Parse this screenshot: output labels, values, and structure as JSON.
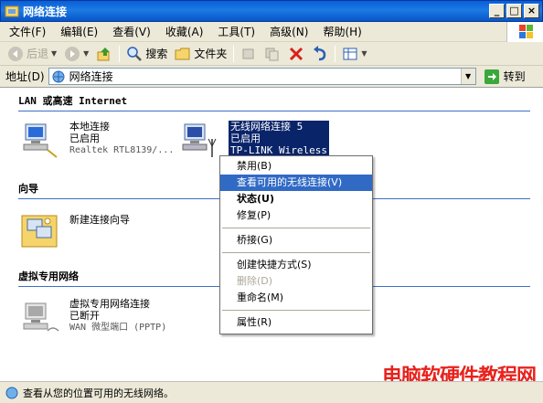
{
  "window": {
    "title": "网络连接"
  },
  "menu": [
    "文件(F)",
    "编辑(E)",
    "查看(V)",
    "收藏(A)",
    "工具(T)",
    "高级(N)",
    "帮助(H)"
  ],
  "toolbar": {
    "back": "后退",
    "search": "搜索",
    "folders": "文件夹"
  },
  "address": {
    "label": "地址(D)",
    "value": "网络连接",
    "go": "转到"
  },
  "groups": {
    "lan": "LAN 或高速 Internet",
    "wizard": "向导",
    "vpn": "虚拟专用网络"
  },
  "items": {
    "local": {
      "name": "本地连接",
      "status": "已启用",
      "device": "Realtek RTL8139/..."
    },
    "wireless": {
      "name": "无线网络连接 5",
      "status": "已启用",
      "device": "TP-LINK Wireless"
    },
    "newconn": {
      "name": "新建连接向导"
    },
    "vpnconn": {
      "name": "虚拟专用网络连接",
      "status": "已断开",
      "device": "WAN 微型端口 (PPTP)"
    }
  },
  "context_menu": [
    {
      "label": "禁用(B)",
      "style": "normal"
    },
    {
      "label": "查看可用的无线连接(V)",
      "style": "highlight"
    },
    {
      "label": "状态(U)",
      "style": "bold"
    },
    {
      "label": "修复(P)",
      "style": "normal"
    },
    {
      "label": "桥接(G)",
      "style": "normal"
    },
    {
      "label": "创建快捷方式(S)",
      "style": "normal"
    },
    {
      "label": "删除(D)",
      "style": "disabled"
    },
    {
      "label": "重命名(M)",
      "style": "normal"
    },
    {
      "label": "属性(R)",
      "style": "normal"
    }
  ],
  "status": {
    "text": "查看从您的位置可用的无线网络。"
  },
  "watermark": "电脑软硬件教程网",
  "colors": {
    "titlebar": "#0a5fd8",
    "highlight": "#316ac5",
    "selection": "#0a246a",
    "watermark": "#e8221c"
  }
}
